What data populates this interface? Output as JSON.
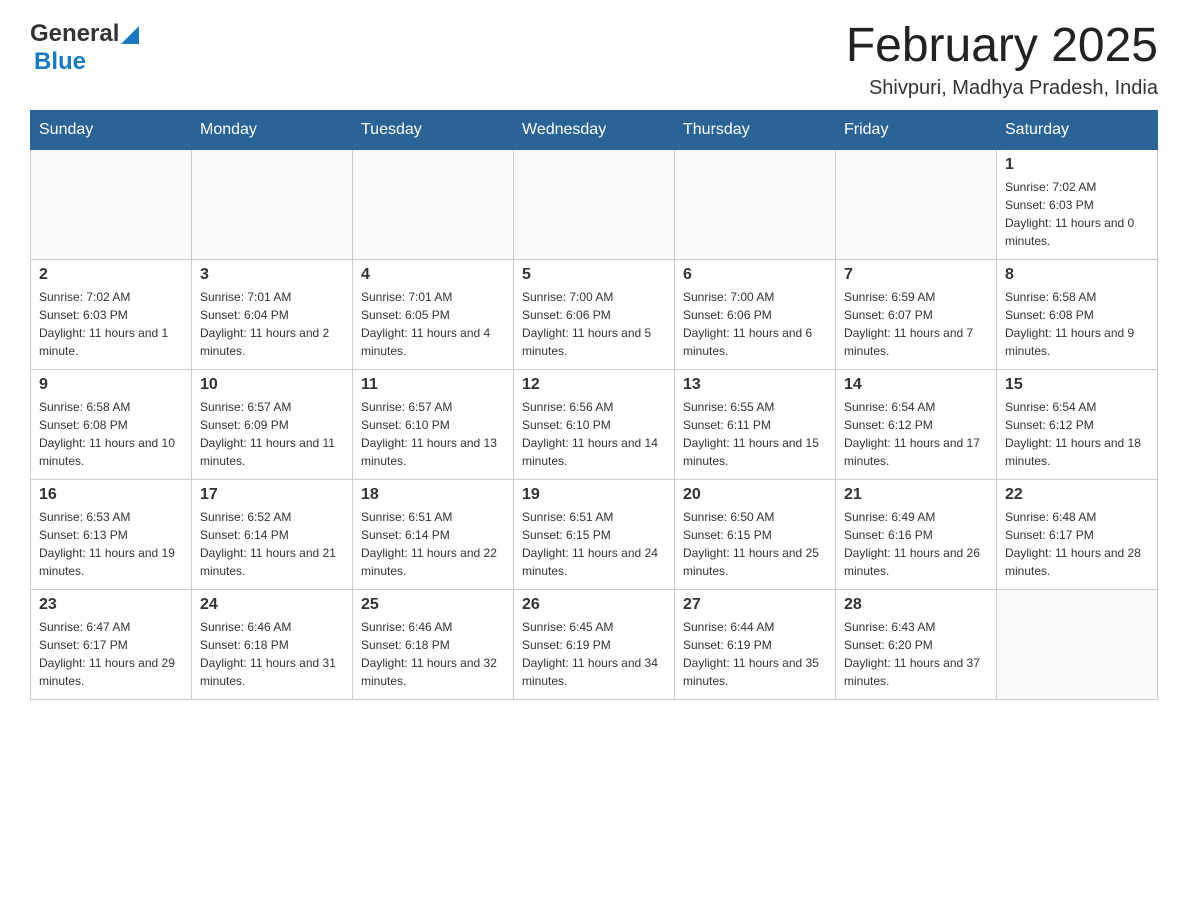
{
  "header": {
    "logo_general": "General",
    "logo_blue": "Blue",
    "month_title": "February 2025",
    "location": "Shivpuri, Madhya Pradesh, India"
  },
  "days_of_week": [
    "Sunday",
    "Monday",
    "Tuesday",
    "Wednesday",
    "Thursday",
    "Friday",
    "Saturday"
  ],
  "weeks": [
    [
      {
        "day": "",
        "sunrise": "",
        "sunset": "",
        "daylight": ""
      },
      {
        "day": "",
        "sunrise": "",
        "sunset": "",
        "daylight": ""
      },
      {
        "day": "",
        "sunrise": "",
        "sunset": "",
        "daylight": ""
      },
      {
        "day": "",
        "sunrise": "",
        "sunset": "",
        "daylight": ""
      },
      {
        "day": "",
        "sunrise": "",
        "sunset": "",
        "daylight": ""
      },
      {
        "day": "",
        "sunrise": "",
        "sunset": "",
        "daylight": ""
      },
      {
        "day": "1",
        "sunrise": "Sunrise: 7:02 AM",
        "sunset": "Sunset: 6:03 PM",
        "daylight": "Daylight: 11 hours and 0 minutes."
      }
    ],
    [
      {
        "day": "2",
        "sunrise": "Sunrise: 7:02 AM",
        "sunset": "Sunset: 6:03 PM",
        "daylight": "Daylight: 11 hours and 1 minute."
      },
      {
        "day": "3",
        "sunrise": "Sunrise: 7:01 AM",
        "sunset": "Sunset: 6:04 PM",
        "daylight": "Daylight: 11 hours and 2 minutes."
      },
      {
        "day": "4",
        "sunrise": "Sunrise: 7:01 AM",
        "sunset": "Sunset: 6:05 PM",
        "daylight": "Daylight: 11 hours and 4 minutes."
      },
      {
        "day": "5",
        "sunrise": "Sunrise: 7:00 AM",
        "sunset": "Sunset: 6:06 PM",
        "daylight": "Daylight: 11 hours and 5 minutes."
      },
      {
        "day": "6",
        "sunrise": "Sunrise: 7:00 AM",
        "sunset": "Sunset: 6:06 PM",
        "daylight": "Daylight: 11 hours and 6 minutes."
      },
      {
        "day": "7",
        "sunrise": "Sunrise: 6:59 AM",
        "sunset": "Sunset: 6:07 PM",
        "daylight": "Daylight: 11 hours and 7 minutes."
      },
      {
        "day": "8",
        "sunrise": "Sunrise: 6:58 AM",
        "sunset": "Sunset: 6:08 PM",
        "daylight": "Daylight: 11 hours and 9 minutes."
      }
    ],
    [
      {
        "day": "9",
        "sunrise": "Sunrise: 6:58 AM",
        "sunset": "Sunset: 6:08 PM",
        "daylight": "Daylight: 11 hours and 10 minutes."
      },
      {
        "day": "10",
        "sunrise": "Sunrise: 6:57 AM",
        "sunset": "Sunset: 6:09 PM",
        "daylight": "Daylight: 11 hours and 11 minutes."
      },
      {
        "day": "11",
        "sunrise": "Sunrise: 6:57 AM",
        "sunset": "Sunset: 6:10 PM",
        "daylight": "Daylight: 11 hours and 13 minutes."
      },
      {
        "day": "12",
        "sunrise": "Sunrise: 6:56 AM",
        "sunset": "Sunset: 6:10 PM",
        "daylight": "Daylight: 11 hours and 14 minutes."
      },
      {
        "day": "13",
        "sunrise": "Sunrise: 6:55 AM",
        "sunset": "Sunset: 6:11 PM",
        "daylight": "Daylight: 11 hours and 15 minutes."
      },
      {
        "day": "14",
        "sunrise": "Sunrise: 6:54 AM",
        "sunset": "Sunset: 6:12 PM",
        "daylight": "Daylight: 11 hours and 17 minutes."
      },
      {
        "day": "15",
        "sunrise": "Sunrise: 6:54 AM",
        "sunset": "Sunset: 6:12 PM",
        "daylight": "Daylight: 11 hours and 18 minutes."
      }
    ],
    [
      {
        "day": "16",
        "sunrise": "Sunrise: 6:53 AM",
        "sunset": "Sunset: 6:13 PM",
        "daylight": "Daylight: 11 hours and 19 minutes."
      },
      {
        "day": "17",
        "sunrise": "Sunrise: 6:52 AM",
        "sunset": "Sunset: 6:14 PM",
        "daylight": "Daylight: 11 hours and 21 minutes."
      },
      {
        "day": "18",
        "sunrise": "Sunrise: 6:51 AM",
        "sunset": "Sunset: 6:14 PM",
        "daylight": "Daylight: 11 hours and 22 minutes."
      },
      {
        "day": "19",
        "sunrise": "Sunrise: 6:51 AM",
        "sunset": "Sunset: 6:15 PM",
        "daylight": "Daylight: 11 hours and 24 minutes."
      },
      {
        "day": "20",
        "sunrise": "Sunrise: 6:50 AM",
        "sunset": "Sunset: 6:15 PM",
        "daylight": "Daylight: 11 hours and 25 minutes."
      },
      {
        "day": "21",
        "sunrise": "Sunrise: 6:49 AM",
        "sunset": "Sunset: 6:16 PM",
        "daylight": "Daylight: 11 hours and 26 minutes."
      },
      {
        "day": "22",
        "sunrise": "Sunrise: 6:48 AM",
        "sunset": "Sunset: 6:17 PM",
        "daylight": "Daylight: 11 hours and 28 minutes."
      }
    ],
    [
      {
        "day": "23",
        "sunrise": "Sunrise: 6:47 AM",
        "sunset": "Sunset: 6:17 PM",
        "daylight": "Daylight: 11 hours and 29 minutes."
      },
      {
        "day": "24",
        "sunrise": "Sunrise: 6:46 AM",
        "sunset": "Sunset: 6:18 PM",
        "daylight": "Daylight: 11 hours and 31 minutes."
      },
      {
        "day": "25",
        "sunrise": "Sunrise: 6:46 AM",
        "sunset": "Sunset: 6:18 PM",
        "daylight": "Daylight: 11 hours and 32 minutes."
      },
      {
        "day": "26",
        "sunrise": "Sunrise: 6:45 AM",
        "sunset": "Sunset: 6:19 PM",
        "daylight": "Daylight: 11 hours and 34 minutes."
      },
      {
        "day": "27",
        "sunrise": "Sunrise: 6:44 AM",
        "sunset": "Sunset: 6:19 PM",
        "daylight": "Daylight: 11 hours and 35 minutes."
      },
      {
        "day": "28",
        "sunrise": "Sunrise: 6:43 AM",
        "sunset": "Sunset: 6:20 PM",
        "daylight": "Daylight: 11 hours and 37 minutes."
      },
      {
        "day": "",
        "sunrise": "",
        "sunset": "",
        "daylight": ""
      }
    ]
  ]
}
